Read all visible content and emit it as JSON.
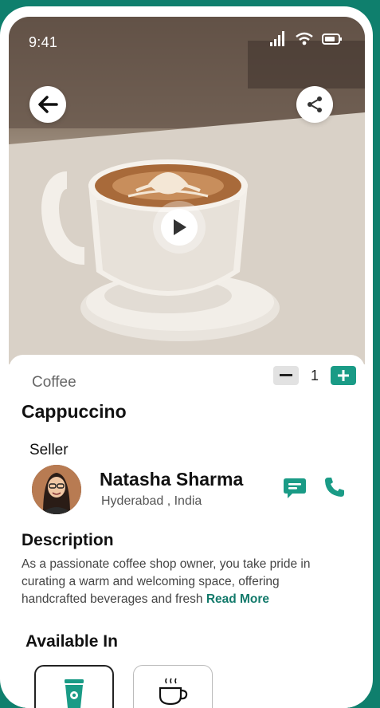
{
  "status_bar": {
    "time": "9:41"
  },
  "product": {
    "category": "Coffee",
    "name": "Cappuccino",
    "quantity": "1"
  },
  "seller": {
    "label": "Seller",
    "name": "Natasha Sharma",
    "location": "Hyderabad , India"
  },
  "description": {
    "title": "Description",
    "text": "As a passionate coffee shop owner, you take pride in curating a warm and welcoming space, offering handcrafted beverages and fresh",
    "read_more": "Read More"
  },
  "available_in": {
    "title": "Available In",
    "options": [
      {
        "icon": "takeaway-cup-icon",
        "selected": true
      },
      {
        "icon": "hot-cup-icon",
        "selected": false
      }
    ]
  },
  "colors": {
    "accent": "#1a9b86",
    "background": "#0f7f6d"
  }
}
